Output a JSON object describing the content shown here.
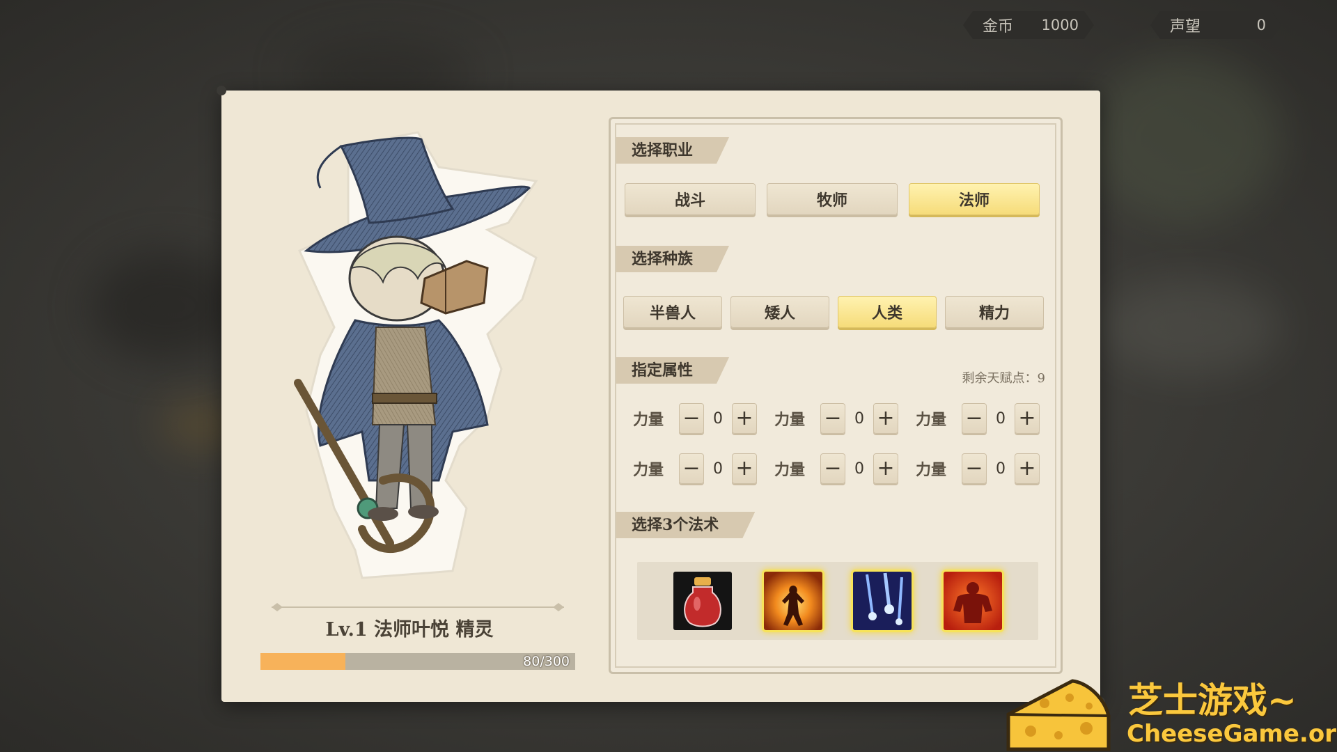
{
  "currency": {
    "gold_label": "金币",
    "gold_value": "1000",
    "fame_label": "声望",
    "fame_value": "0"
  },
  "character": {
    "name_line": "Lv.1 法师叶悦 精灵",
    "xp_text": "80/300",
    "xp_fraction": 0.27
  },
  "profession": {
    "title": "选择职业",
    "options": [
      "战斗",
      "牧师",
      "法师"
    ],
    "selected": "法师"
  },
  "race": {
    "title": "选择种族",
    "options": [
      "半兽人",
      "矮人",
      "人类",
      "精力"
    ],
    "selected": "人类"
  },
  "attributes": {
    "title": "指定属性",
    "remaining": "剩余天赋点：9",
    "items": [
      {
        "label": "力量",
        "value": "0"
      },
      {
        "label": "力量",
        "value": "0"
      },
      {
        "label": "力量",
        "value": "0"
      },
      {
        "label": "力量",
        "value": "0"
      },
      {
        "label": "力量",
        "value": "0"
      },
      {
        "label": "力量",
        "value": "0"
      }
    ],
    "minus": "−",
    "plus": "+"
  },
  "spells": {
    "title": "选择3个法术",
    "items": [
      {
        "icon": "red-potion-icon",
        "selected": false
      },
      {
        "icon": "fire-aura-icon",
        "selected": true
      },
      {
        "icon": "blue-meteor-icon",
        "selected": true
      },
      {
        "icon": "berserk-rage-icon",
        "selected": true
      }
    ]
  },
  "watermark": {
    "title": "芝士游戏~",
    "url": "CheeseGame.org"
  }
}
